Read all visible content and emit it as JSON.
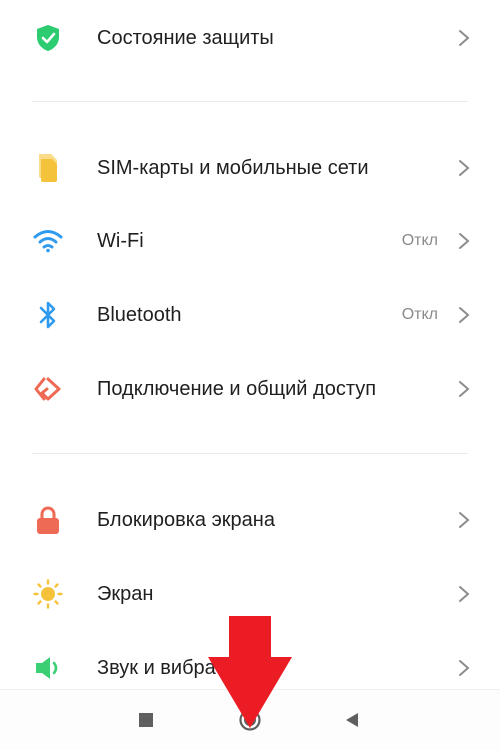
{
  "security": {
    "label": "Состояние защиты"
  },
  "connectivity": [
    {
      "label": "SIM-карты и мобильные сети",
      "value": "",
      "icon": "sim-card-icon",
      "color": "#f5c33b"
    },
    {
      "label": "Wi-Fi",
      "value": "Откл",
      "icon": "wifi-icon",
      "color": "#2f9bf0"
    },
    {
      "label": "Bluetooth",
      "value": "Откл",
      "icon": "bluetooth-icon",
      "color": "#2f9bf0"
    },
    {
      "label": "Подключение и общий доступ",
      "value": "",
      "icon": "share-connection-icon",
      "color": "#ee6a55"
    }
  ],
  "device": [
    {
      "label": "Блокировка экрана",
      "icon": "lock-icon",
      "color": "#ee6a55"
    },
    {
      "label": "Экран",
      "icon": "sun-icon",
      "color": "#f5c33b"
    },
    {
      "label": "Звук и вибра",
      "icon": "speaker-icon",
      "color": "#3bcf74"
    }
  ],
  "colors": {
    "shield": "#2ecc71",
    "arrow": "#ec1c24",
    "nav": "#5f5f5f"
  },
  "navbar": {
    "recents": "square-icon",
    "home": "circle-icon",
    "back": "triangle-back-icon"
  }
}
